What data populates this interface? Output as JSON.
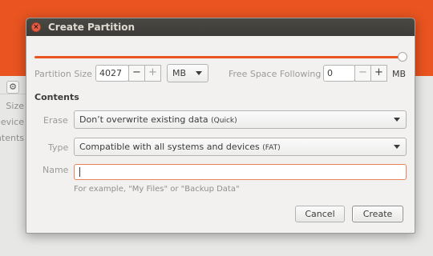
{
  "background": {
    "side_labels": [
      "Size",
      "Device",
      "Contents"
    ]
  },
  "dialog": {
    "title": "Create Partition",
    "close_icon": "close-icon",
    "slider": {
      "value_fraction": 1.0,
      "accent": "#e95420"
    },
    "partition_size": {
      "label": "Partition Size",
      "value": "4027",
      "minus": "−",
      "plus": "+",
      "unit": "MB"
    },
    "free_space": {
      "label": "Free Space Following",
      "value": "0",
      "minus": "−",
      "plus": "+",
      "unit": "MB"
    },
    "contents": {
      "heading": "Contents",
      "erase": {
        "label": "Erase",
        "value": "Don’t overwrite existing data",
        "value_note": "(Quick)"
      },
      "type": {
        "label": "Type",
        "value": "Compatible with all systems and devices",
        "value_note": "(FAT)"
      },
      "name": {
        "label": "Name",
        "value": "",
        "hint": "For example, \"My Files\" or \"Backup Data\""
      }
    },
    "buttons": {
      "cancel": "Cancel",
      "create": "Create"
    }
  }
}
